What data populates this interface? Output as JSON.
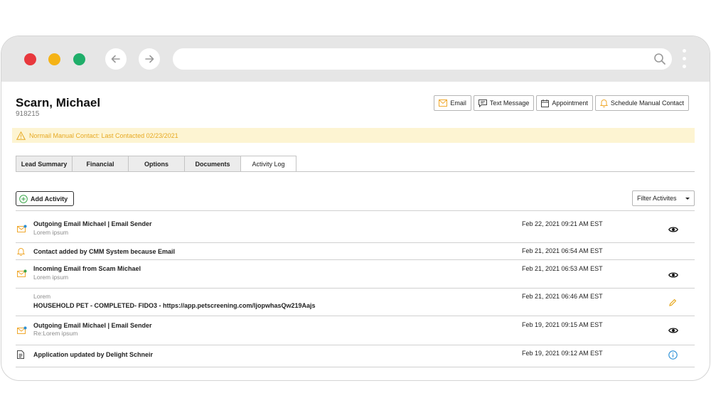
{
  "lead": {
    "name": "Scarn, Michael",
    "id": "918215"
  },
  "actions": [
    {
      "label": "Email",
      "icon": "envelope-icon"
    },
    {
      "label": "Text Message",
      "icon": "chat-icon"
    },
    {
      "label": "Appointment",
      "icon": "calendar-icon"
    },
    {
      "label": "Schedule Manual Contact",
      "icon": "bell-icon"
    }
  ],
  "alert": {
    "text": "Normail Manual Contact: Last Contacted 02/23/2021",
    "icon": "warning-icon",
    "color": "#e7a922"
  },
  "tabs": [
    "Lead Summary",
    "Financial",
    "Options",
    "Documents",
    "Activity Log"
  ],
  "active_tab": "Activity Log",
  "add_activity_label": "Add Activity",
  "filter_label": "Filter Activites",
  "activities": [
    {
      "title": "Outgoing Email Michael | Email Sender",
      "sub": "Lorem ipsum",
      "date": "Feb 22, 2021 09:21 AM EST",
      "icon": "email-out-icon",
      "action": "view-eye-icon"
    },
    {
      "title": "Contact added by CMM System because Email",
      "sub": "",
      "date": "Feb 21, 2021 06:54 AM EST",
      "icon": "bell-icon",
      "action": ""
    },
    {
      "title": "Incoming Email from Scam Michael",
      "sub": "Lorem ipsum",
      "date": "Feb 21, 2021 06:53 AM EST",
      "icon": "email-in-icon",
      "action": "view-eye-icon"
    },
    {
      "title": "HOUSEHOLD PET - COMPLETED- FIDO3 - https://app.petscreening.com/ljopwhasQw219Aajs",
      "sub": "Lorem",
      "date": "Feb 21, 2021 06:46 AM EST",
      "icon": "",
      "action": "edit-pencil-icon"
    },
    {
      "title": "Outgoing Email Michael | Email Sender",
      "sub": "Re:Lorem ipsum",
      "date": "Feb 19, 2021 09:15 AM EST",
      "icon": "email-out-icon",
      "action": "view-eye-icon"
    },
    {
      "title": "Application updated by Delight Schneir",
      "sub": "",
      "date": "Feb 19, 2021 09:12 AM EST",
      "icon": "document-icon",
      "action": "info-icon"
    }
  ],
  "colors": {
    "accent_yellow": "#f5b316",
    "alert_bg": "#fdf4d2",
    "info_blue": "#2a8fd6",
    "add_green": "#3aa64a"
  }
}
